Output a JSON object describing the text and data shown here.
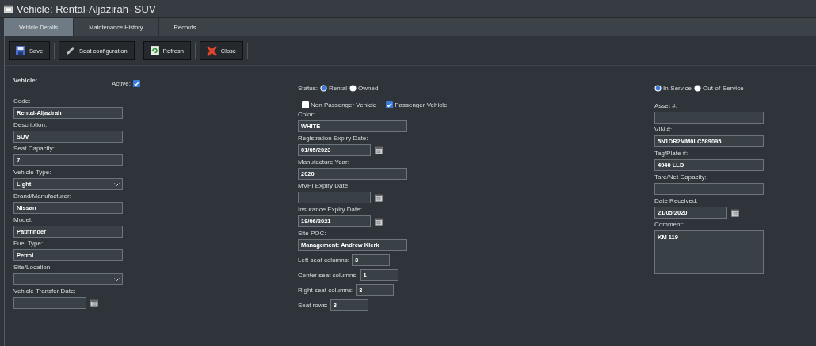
{
  "window": {
    "title": "Vehicle: Rental-Aljazirah- SUV"
  },
  "tabs": [
    {
      "label": "Vehicle Details",
      "selected": true
    },
    {
      "label": "Maintenance History",
      "selected": false
    },
    {
      "label": "Records",
      "selected": false
    }
  ],
  "toolbar": [
    {
      "label": "Save",
      "kind": "save"
    },
    {
      "label": "Seat configuration",
      "kind": "edit"
    },
    {
      "label": "Refresh",
      "kind": "refresh"
    },
    {
      "label": "Close",
      "kind": "close"
    }
  ],
  "left": {
    "heading": "Vehicle:",
    "active": {
      "label": "Active:",
      "checked": true
    },
    "fields": [
      {
        "kind": "text",
        "label": "Code:",
        "value": "Rental-Aljazirah"
      },
      {
        "kind": "text",
        "label": "Description:",
        "value": "SUV"
      },
      {
        "kind": "text",
        "label": "Seat Capacity:",
        "value": "7"
      },
      {
        "kind": "select",
        "label": "Vehicle Type:",
        "value": "Light"
      },
      {
        "kind": "text",
        "label": "Brand/Manufacturer:",
        "value": "Nissan"
      },
      {
        "kind": "text",
        "label": "Model:",
        "value": "Pathfinder"
      },
      {
        "kind": "text",
        "label": "Fuel Type:",
        "value": "Petrol"
      },
      {
        "kind": "select",
        "label": "Site/Location:"
      },
      {
        "kind": "date",
        "label": "Vehicle Transfer Date:"
      }
    ]
  },
  "middle": {
    "status": {
      "label": "Status:",
      "options": [
        {
          "label": "Rental",
          "selected": true
        },
        {
          "label": "Owned",
          "selected": false
        }
      ]
    },
    "checkboxes": [
      {
        "label": "Non Passenger Vehicle",
        "checked": false
      },
      {
        "label": "Passenger Vehicle",
        "checked": true
      }
    ],
    "fields": [
      {
        "kind": "text",
        "label": "Color:",
        "value": "WHITE"
      },
      {
        "kind": "date",
        "label": "Registration Expiry Date:",
        "value": "01/05/2023"
      },
      {
        "kind": "text",
        "label": "Manufacture Year:",
        "value": "2020"
      },
      {
        "kind": "date",
        "label": "MVPI Expiry Date:"
      },
      {
        "kind": "date",
        "label": "Insurance Expiry Date:",
        "value": "19/06/2021"
      },
      {
        "kind": "text",
        "label": "Site POC:",
        "value": "Management: Andrew Klerk"
      },
      {
        "kind": "inline",
        "label": "Left seat columns:",
        "value": "3"
      },
      {
        "kind": "inline",
        "label": "Center seat columns:",
        "value": "1"
      },
      {
        "kind": "inline",
        "label": "Right seat columns:",
        "value": "3"
      },
      {
        "kind": "inline",
        "label": "Seat rows:",
        "value": "3"
      }
    ]
  },
  "right": {
    "service": [
      {
        "label": "In-Service",
        "selected": true
      },
      {
        "label": "Out-of-Service",
        "selected": false
      }
    ],
    "fields": [
      {
        "kind": "text",
        "label": "Asset #:"
      },
      {
        "kind": "text",
        "label": "VIN #:",
        "value": "5N1DR2MM0LC589095"
      },
      {
        "kind": "text",
        "label": "Tag/Plate #:",
        "value": "4940 LLD"
      },
      {
        "kind": "text",
        "label": "Tare/Net Capacity:"
      },
      {
        "kind": "date",
        "label": "Date Received:",
        "value": "21/05/2020"
      },
      {
        "kind": "textarea",
        "label": "Comment:",
        "value": "KM 119 -"
      }
    ]
  }
}
